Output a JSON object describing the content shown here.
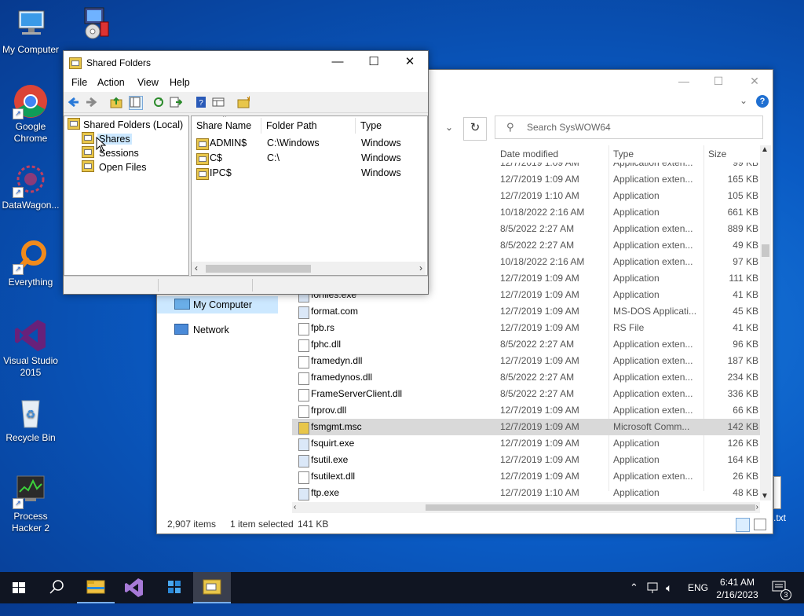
{
  "desktop": {
    "icons": [
      {
        "label": "My Computer"
      },
      {
        "label": "Google Chrome"
      },
      {
        "label": "DataWagon..."
      },
      {
        "label": "Everything"
      },
      {
        "label": "Visual Studio 2015"
      },
      {
        "label": "Recycle Bin"
      },
      {
        "label": "Process Hacker 2"
      }
    ],
    "partial_file_label": ".txt"
  },
  "explorer": {
    "search_placeholder": "Search SysWOW64",
    "columns": {
      "date": "Date modified",
      "type": "Type",
      "size": "Size"
    },
    "nav": {
      "my_computer": "My Computer",
      "network": "Network"
    },
    "files": [
      {
        "name": "",
        "date": "12/7/2019 1:09 AM",
        "type": "Application exten...",
        "size": "99 KB"
      },
      {
        "name": "",
        "date": "12/7/2019 1:09 AM",
        "type": "Application exten...",
        "size": "165 KB"
      },
      {
        "name": "",
        "date": "12/7/2019 1:10 AM",
        "type": "Application",
        "size": "105 KB"
      },
      {
        "name": "",
        "date": "10/18/2022 2:16 AM",
        "type": "Application",
        "size": "661 KB"
      },
      {
        "name": "",
        "date": "8/5/2022 2:27 AM",
        "type": "Application exten...",
        "size": "889 KB"
      },
      {
        "name": "",
        "date": "8/5/2022 2:27 AM",
        "type": "Application exten...",
        "size": "49 KB"
      },
      {
        "name": "",
        "date": "10/18/2022 2:16 AM",
        "type": "Application exten...",
        "size": "97 KB"
      },
      {
        "name": "",
        "date": "12/7/2019 1:09 AM",
        "type": "Application",
        "size": "111 KB"
      },
      {
        "name": "forfiles.exe",
        "date": "12/7/2019 1:09 AM",
        "type": "Application",
        "size": "41 KB"
      },
      {
        "name": "format.com",
        "date": "12/7/2019 1:09 AM",
        "type": "MS-DOS Applicati...",
        "size": "45 KB"
      },
      {
        "name": "fpb.rs",
        "date": "12/7/2019 1:09 AM",
        "type": "RS File",
        "size": "41 KB"
      },
      {
        "name": "fphc.dll",
        "date": "8/5/2022 2:27 AM",
        "type": "Application exten...",
        "size": "96 KB"
      },
      {
        "name": "framedyn.dll",
        "date": "12/7/2019 1:09 AM",
        "type": "Application exten...",
        "size": "187 KB"
      },
      {
        "name": "framedynos.dll",
        "date": "8/5/2022 2:27 AM",
        "type": "Application exten...",
        "size": "234 KB"
      },
      {
        "name": "FrameServerClient.dll",
        "date": "8/5/2022 2:27 AM",
        "type": "Application exten...",
        "size": "336 KB"
      },
      {
        "name": "frprov.dll",
        "date": "12/7/2019 1:09 AM",
        "type": "Application exten...",
        "size": "66 KB"
      },
      {
        "name": "fsmgmt.msc",
        "date": "12/7/2019 1:09 AM",
        "type": "Microsoft Comm...",
        "size": "142 KB"
      },
      {
        "name": "fsquirt.exe",
        "date": "12/7/2019 1:09 AM",
        "type": "Application",
        "size": "126 KB"
      },
      {
        "name": "fsutil.exe",
        "date": "12/7/2019 1:09 AM",
        "type": "Application",
        "size": "164 KB"
      },
      {
        "name": "fsutilext.dll",
        "date": "12/7/2019 1:09 AM",
        "type": "Application exten...",
        "size": "26 KB"
      },
      {
        "name": "ftp.exe",
        "date": "12/7/2019 1:10 AM",
        "type": "Application",
        "size": "48 KB"
      }
    ],
    "selected_index": 16,
    "status": {
      "items": "2,907 items",
      "selected": "1 item selected",
      "size": "141 KB"
    }
  },
  "shared_folders": {
    "title": "Shared Folders",
    "menu": [
      "File",
      "Action",
      "View",
      "Help"
    ],
    "tree": {
      "root": "Shared Folders (Local)",
      "children": [
        "Shares",
        "Sessions",
        "Open Files"
      ],
      "selected": "Shares"
    },
    "columns": {
      "share_name": "Share Name",
      "folder_path": "Folder Path",
      "type": "Type"
    },
    "shares": [
      {
        "name": "ADMIN$",
        "path": "C:\\Windows",
        "type": "Windows"
      },
      {
        "name": "C$",
        "path": "C:\\",
        "type": "Windows"
      },
      {
        "name": "IPC$",
        "path": "",
        "type": "Windows"
      }
    ]
  },
  "taskbar": {
    "language": "ENG",
    "time": "6:41 AM",
    "date": "2/16/2023",
    "notification_count": "3"
  },
  "colors": {
    "accent": "#0078d7",
    "selection": "#cce8ff",
    "taskbar": "#101522"
  }
}
